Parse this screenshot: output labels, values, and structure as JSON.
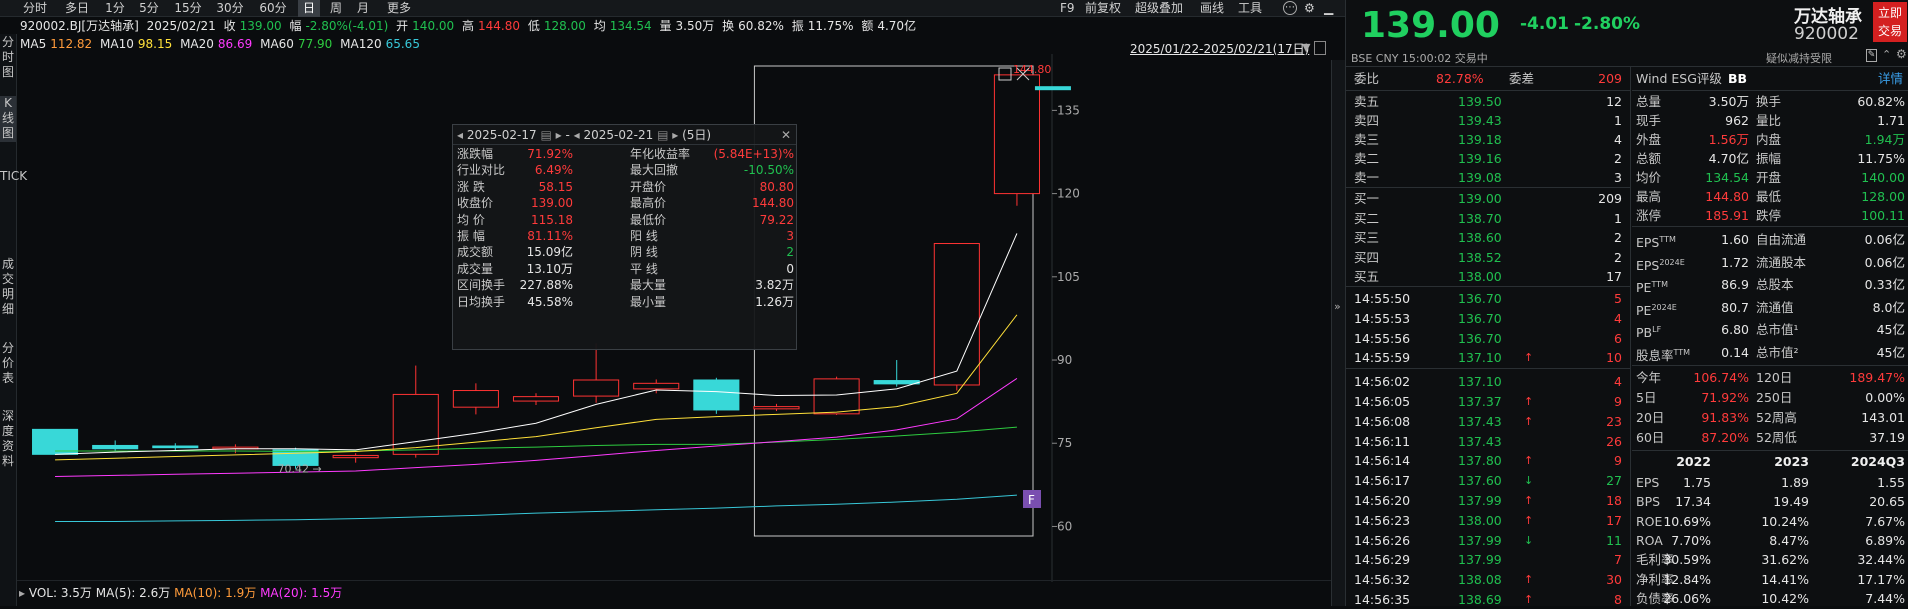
{
  "toolbar": {
    "timeframes": [
      "分时",
      "多日",
      "1分",
      "5分",
      "15分",
      "30分",
      "60分",
      "日",
      "周",
      "月",
      "更多"
    ],
    "active_timeframe": "日",
    "right_items": [
      "F9",
      "前复权",
      "超级叠加",
      "画线",
      "工具"
    ]
  },
  "side_tabs": [
    "分时图",
    "K线图",
    "TICK",
    "成交明细",
    "分价表",
    "深度资料"
  ],
  "info_line": {
    "code_name": "920002.BJ[万达轴承]",
    "date": "2025/02/21",
    "close_label": "收",
    "close": "139.00",
    "change_label": "幅",
    "change": "-2.80%(-4.01)",
    "open_label": "开",
    "open": "140.00",
    "high_label": "高",
    "high": "144.80",
    "low_label": "低",
    "low": "128.00",
    "avg_label": "均",
    "avg": "134.54",
    "vol_label": "量",
    "vol": "3.50万",
    "turn_label": "换",
    "turn": "60.82%",
    "amp_label": "振",
    "amp": "11.75%",
    "amt_label": "额",
    "amt": "4.70亿"
  },
  "ma_line": {
    "ma5_label": "MA5",
    "ma5": "112.82",
    "ma10_label": "MA10",
    "ma10": "98.15",
    "ma20_label": "MA20",
    "ma20": "86.69",
    "ma60_label": "MA60",
    "ma60": "77.90",
    "ma120_label": "MA120",
    "ma120": "65.65",
    "range": "2025/01/22-2025/02/21(17日)"
  },
  "chart_data": {
    "type": "candlestick",
    "y_ticks": [
      "135",
      "120",
      "105",
      "90",
      "75",
      "60"
    ],
    "ylim": [
      59,
      143
    ],
    "candles": [
      {
        "o": 77.5,
        "c": 73.0,
        "h": 77.5,
        "l": 73.0
      },
      {
        "o": 74.6,
        "c": 74.0,
        "h": 75.5,
        "l": 73.5
      },
      {
        "o": 74.5,
        "c": 74.2,
        "h": 75.0,
        "l": 73.8
      },
      {
        "o": 74.0,
        "c": 74.3,
        "h": 74.8,
        "l": 73.2
      },
      {
        "o": 73.8,
        "c": 71.0,
        "h": 74.2,
        "l": 70.4
      },
      {
        "o": 72.4,
        "c": 72.8,
        "h": 73.2,
        "l": 71.5
      },
      {
        "o": 73.0,
        "c": 83.8,
        "h": 89.0,
        "l": 72.4
      },
      {
        "o": 81.5,
        "c": 84.5,
        "h": 85.8,
        "l": 80.2
      },
      {
        "o": 82.6,
        "c": 83.4,
        "h": 84.0,
        "l": 81.9
      },
      {
        "o": 83.5,
        "c": 86.4,
        "h": 93.0,
        "l": 82.3
      },
      {
        "o": 84.8,
        "c": 85.8,
        "h": 86.5,
        "l": 84.0
      },
      {
        "o": 86.4,
        "c": 81.0,
        "h": 86.8,
        "l": 80.3
      },
      {
        "o": 81.2,
        "c": 81.6,
        "h": 82.1,
        "l": 80.8
      },
      {
        "o": 80.3,
        "c": 86.6,
        "h": 87.0,
        "l": 80.1
      },
      {
        "o": 86.3,
        "c": 85.7,
        "h": 90.0,
        "l": 85.2
      },
      {
        "o": 85.5,
        "c": 111.0,
        "h": 111.0,
        "l": 84.5
      },
      {
        "o": 120.0,
        "c": 141.4,
        "h": 141.4,
        "l": 117.8
      }
    ],
    "last_marker": 139.0,
    "low_label": "70.42",
    "high_label": "144.80",
    "ma5": [
      73,
      73.4,
      73.7,
      74,
      74,
      73.8,
      75.3,
      76.8,
      78.6,
      82,
      84.6,
      84.3,
      83.6,
      83.7,
      84.8,
      88,
      112.82
    ],
    "ma10": [
      72,
      72.3,
      72.6,
      72.9,
      73.2,
      73.5,
      74.2,
      75.2,
      76.2,
      77.8,
      79.3,
      79.8,
      80.2,
      80.6,
      81.6,
      84,
      98.15
    ],
    "ma20": [
      69,
      69.2,
      69.4,
      69.6,
      69.8,
      70.0,
      70.6,
      71.2,
      71.9,
      72.8,
      73.7,
      74.5,
      75.3,
      76.1,
      77.4,
      79.4,
      86.69
    ],
    "ma60": [
      73.6,
      73.6,
      73.6,
      73.6,
      73.5,
      73.6,
      73.8,
      74.1,
      74.3,
      74.6,
      74.8,
      74.8,
      75.2,
      75.7,
      76.3,
      77.0,
      77.9
    ],
    "ma120": [
      60.9,
      60.9,
      61.0,
      61.1,
      61.2,
      61.4,
      61.7,
      62.0,
      62.4,
      62.7,
      63.0,
      63.3,
      63.7,
      64.0,
      64.4,
      64.9,
      65.65
    ],
    "colors": {
      "up": "#ff3333",
      "down": "#38d8d8",
      "ma5": "#ffffff",
      "ma10": "#ffe03a",
      "ma20": "#ff3bff",
      "ma60": "#2ecc40",
      "ma120": "#38c8d8"
    }
  },
  "popup": {
    "date_from": "2025-02-17",
    "date_to": "2025-02-21",
    "days": "(5日)",
    "dash": "-",
    "rows": [
      [
        "涨跌幅",
        "71.92%",
        "年化收益率",
        "(5.84E+13)%"
      ],
      [
        "行业对比",
        "6.49%",
        "最大回撤",
        "-10.50%"
      ],
      [
        "涨  跌",
        "58.15",
        "开盘价",
        "80.80"
      ],
      [
        "收盘价",
        "139.00",
        "最高价",
        "144.80"
      ],
      [
        "均  价",
        "115.18",
        "最低价",
        "79.22"
      ],
      [
        "振  幅",
        "81.11%",
        "阳  线",
        "3"
      ],
      [
        "成交额",
        "15.09亿",
        "阴  线",
        "2"
      ],
      [
        "成交量",
        "13.10万",
        "平  线",
        "0"
      ],
      [
        "区间换手",
        "227.88%",
        "最大量",
        "3.82万"
      ],
      [
        "日均换手",
        "45.58%",
        "最小量",
        "1.26万"
      ]
    ]
  },
  "volume_line": {
    "vol": "VOL: 3.5万",
    "ma5": "MA(5): 2.6万",
    "ma10": "MA(10): 1.9万",
    "ma20": "MA(20): 1.5万"
  },
  "quote": {
    "price": "139.00",
    "change": "-4.01",
    "pct": "-2.80%",
    "name": "万达轴承",
    "code": "920002",
    "meta": "BSE  CNY  15:00:02  交易中",
    "buy_button": "立即交易",
    "reduce_note": "疑似减持受限"
  },
  "orderbook": {
    "ratio_label": "委比",
    "ratio": "82.78%",
    "diff_label": "委差",
    "diff": "209",
    "asks": [
      [
        "卖五",
        "139.50",
        "12"
      ],
      [
        "卖四",
        "139.43",
        "1"
      ],
      [
        "卖三",
        "139.18",
        "4"
      ],
      [
        "卖二",
        "139.16",
        "2"
      ],
      [
        "卖一",
        "139.08",
        "3"
      ]
    ],
    "bids": [
      [
        "买一",
        "139.00",
        "209"
      ],
      [
        "买二",
        "138.70",
        "1"
      ],
      [
        "买三",
        "138.60",
        "2"
      ],
      [
        "买四",
        "138.52",
        "2"
      ],
      [
        "买五",
        "138.00",
        "17"
      ]
    ],
    "ticks": [
      [
        "14:55:50",
        "136.70",
        "5",
        ""
      ],
      [
        "14:55:53",
        "136.70",
        "4",
        ""
      ],
      [
        "14:55:56",
        "136.70",
        "6",
        ""
      ],
      [
        "14:55:59",
        "137.10",
        "10",
        "up"
      ],
      [
        "14:56:02",
        "137.10",
        "4",
        ""
      ],
      [
        "14:56:05",
        "137.37",
        "9",
        "up"
      ],
      [
        "14:56:08",
        "137.43",
        "23",
        "up"
      ],
      [
        "14:56:11",
        "137.43",
        "26",
        ""
      ],
      [
        "14:56:14",
        "137.80",
        "9",
        "up"
      ],
      [
        "14:56:17",
        "137.60",
        "27",
        "dn"
      ],
      [
        "14:56:20",
        "137.99",
        "18",
        "up"
      ],
      [
        "14:56:23",
        "138.00",
        "17",
        "up"
      ],
      [
        "14:56:26",
        "137.99",
        "11",
        "dn"
      ],
      [
        "14:56:29",
        "137.99",
        "7",
        ""
      ],
      [
        "14:56:32",
        "138.08",
        "30",
        "up"
      ],
      [
        "14:56:35",
        "138.69",
        "8",
        "up"
      ]
    ]
  },
  "stats": {
    "header": "Wind ESG评级",
    "esg": "BB",
    "detail": "详情",
    "rows": [
      [
        "总量",
        "3.50万",
        "换手",
        "60.82%"
      ],
      [
        "现手",
        "962",
        "量比",
        "1.71"
      ],
      [
        "外盘",
        "1.56万",
        "内盘",
        "1.94万"
      ],
      [
        "总额",
        "4.70亿",
        "振幅",
        "11.75%"
      ],
      [
        "均价",
        "134.54",
        "开盘",
        "140.00"
      ],
      [
        "最高",
        "144.80",
        "最低",
        "128.00"
      ],
      [
        "涨停",
        "185.91",
        "跌停",
        "100.11"
      ]
    ],
    "fund_rows": [
      [
        "EPS",
        "TTM",
        "1.60",
        "自由流通",
        "0.06亿"
      ],
      [
        "EPS",
        "2024E",
        "1.72",
        "流通股本",
        "0.06亿"
      ],
      [
        "PE",
        "TTM",
        "86.9",
        "总股本",
        "0.33亿"
      ],
      [
        "PE",
        "2024E",
        "80.7",
        "流通值",
        "8.0亿"
      ],
      [
        "PB",
        "LF",
        "6.80",
        "总市值¹",
        "45亿"
      ],
      [
        "股息率",
        "TTM",
        "0.14",
        "总市值²",
        "45亿"
      ]
    ],
    "perf_rows": [
      [
        "今年",
        "106.74%",
        "120日",
        "189.47%"
      ],
      [
        "5日",
        "71.92%",
        "250日",
        "0.00%"
      ],
      [
        "20日",
        "91.83%",
        "52周高",
        "143.01"
      ],
      [
        "60日",
        "87.20%",
        "52周低",
        "37.19"
      ]
    ],
    "year_headers": [
      "2022",
      "2023",
      "2024Q3"
    ],
    "fin_rows": [
      [
        "EPS",
        "1.75",
        "1.89",
        "1.55"
      ],
      [
        "BPS",
        "17.34",
        "19.49",
        "20.65"
      ],
      [
        "ROE",
        "10.69%",
        "10.24%",
        "7.67%"
      ],
      [
        "ROA",
        "7.70%",
        "8.47%",
        "6.89%"
      ],
      [
        "毛利率",
        "30.59%",
        "31.62%",
        "32.44%"
      ],
      [
        "净利率",
        "12.84%",
        "14.41%",
        "17.17%"
      ],
      [
        "负债率",
        "26.06%",
        "10.42%",
        "7.44%"
      ]
    ]
  }
}
